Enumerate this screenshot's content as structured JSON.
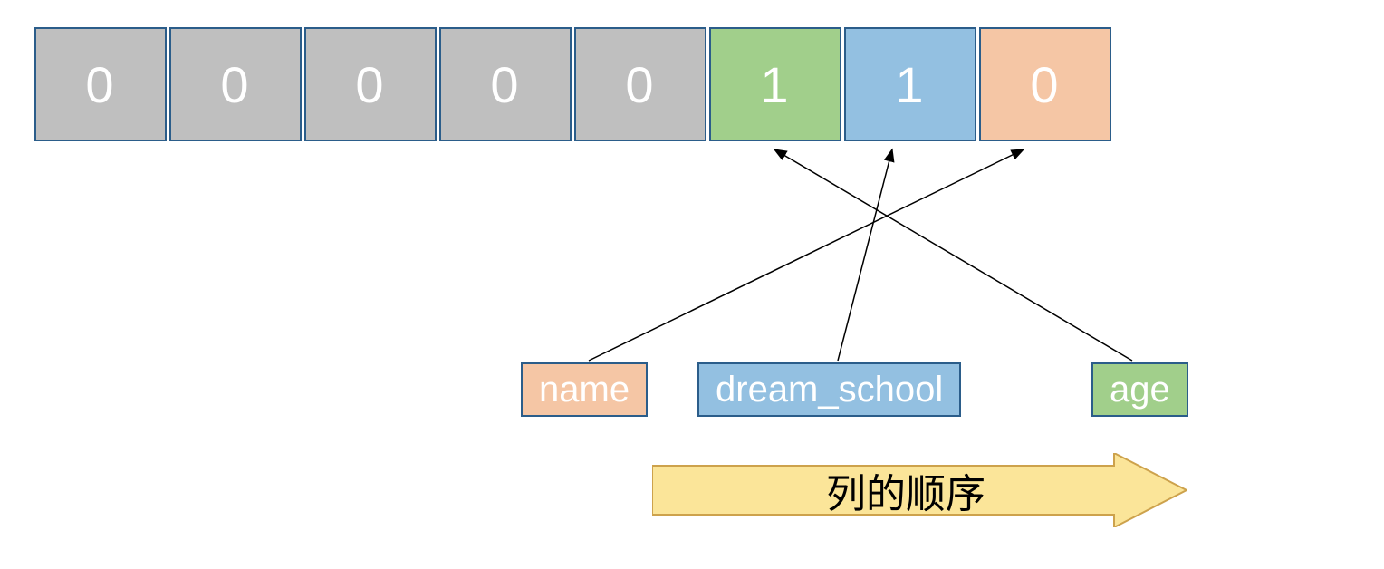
{
  "bits": [
    {
      "value": "0",
      "color": "gray"
    },
    {
      "value": "0",
      "color": "gray"
    },
    {
      "value": "0",
      "color": "gray"
    },
    {
      "value": "0",
      "color": "gray"
    },
    {
      "value": "0",
      "color": "gray"
    },
    {
      "value": "1",
      "color": "green"
    },
    {
      "value": "1",
      "color": "blue"
    },
    {
      "value": "0",
      "color": "peach"
    }
  ],
  "labels": {
    "name": {
      "text": "name",
      "color": "peach"
    },
    "dream": {
      "text": "dream_school",
      "color": "blue"
    },
    "age": {
      "text": "age",
      "color": "green"
    }
  },
  "caption": "列的顺序",
  "mapping_note": "name → bit 8th (peach 0); dream_school → bit 7th (blue 1); age → bit 6th (green 1)"
}
